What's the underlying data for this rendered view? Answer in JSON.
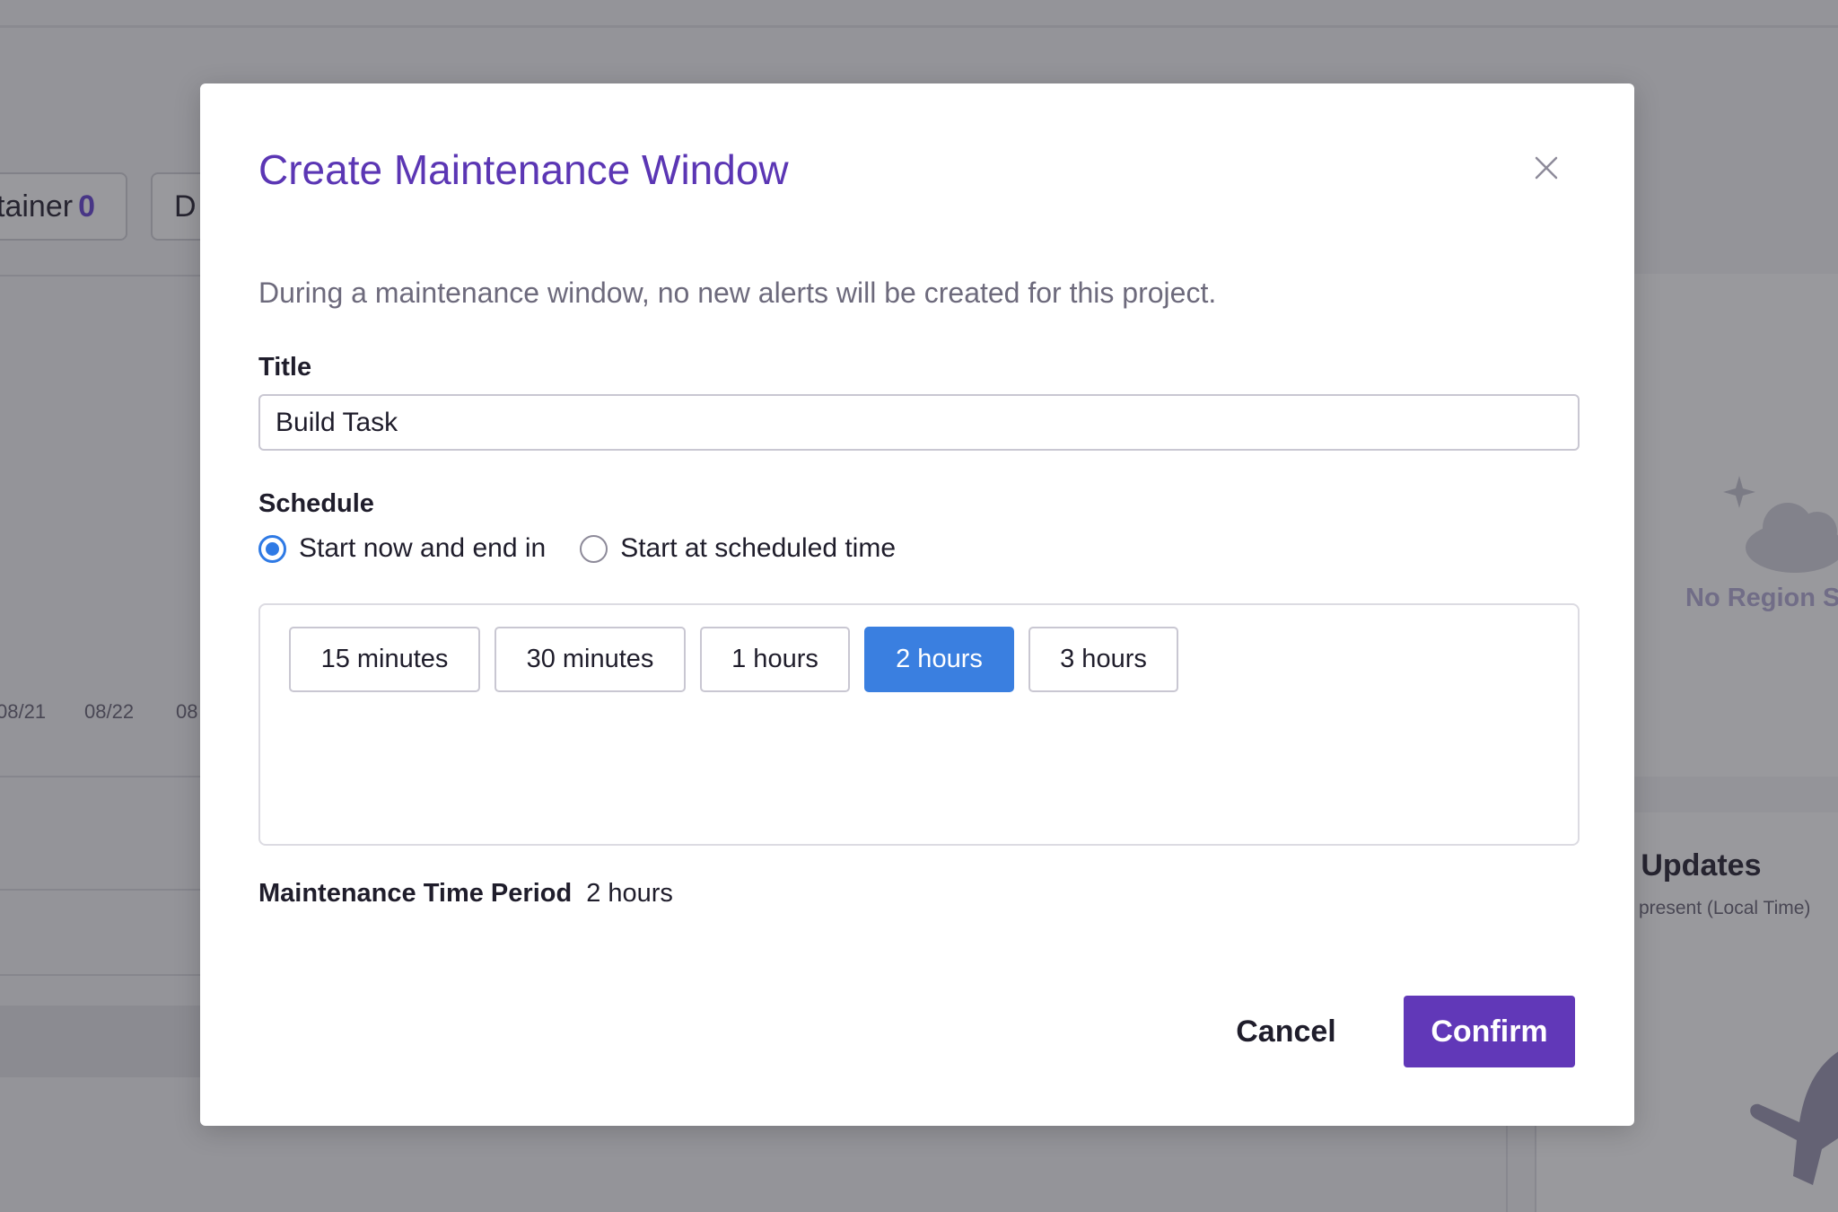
{
  "background": {
    "chip_1": {
      "label": "tainer",
      "count": "0"
    },
    "chip_2": {
      "label": "D"
    },
    "dates": [
      "08/21",
      "08/22",
      "08"
    ],
    "no_region": "No Region S",
    "updates_title": "y Updates",
    "updates_subtitle": "present (Local Time)",
    "icons": [
      "sparkle-icon",
      "cloud-icon",
      "plane-icon"
    ]
  },
  "modal": {
    "title": "Create Maintenance Window",
    "close_icon": "close-icon",
    "description": "During a maintenance window, no new alerts will be created for this project.",
    "title_field": {
      "label": "Title",
      "value": "Build Task"
    },
    "schedule": {
      "label": "Schedule",
      "options": [
        {
          "label": "Start now and end in",
          "checked": true
        },
        {
          "label": "Start at scheduled time",
          "checked": false
        }
      ]
    },
    "durations": [
      {
        "label": "15 minutes",
        "selected": false
      },
      {
        "label": "30 minutes",
        "selected": false
      },
      {
        "label": "1 hours",
        "selected": false
      },
      {
        "label": "2 hours",
        "selected": true
      },
      {
        "label": "3 hours",
        "selected": false
      }
    ],
    "period": {
      "label": "Maintenance Time Period",
      "value": "2 hours"
    },
    "cancel_label": "Cancel",
    "confirm_label": "Confirm"
  },
  "colors": {
    "title": "#5b36b4",
    "accent_blue": "#3a7fe0",
    "confirm_purple": "#6138b8",
    "overlay": "rgba(28,28,38,0.45)"
  }
}
